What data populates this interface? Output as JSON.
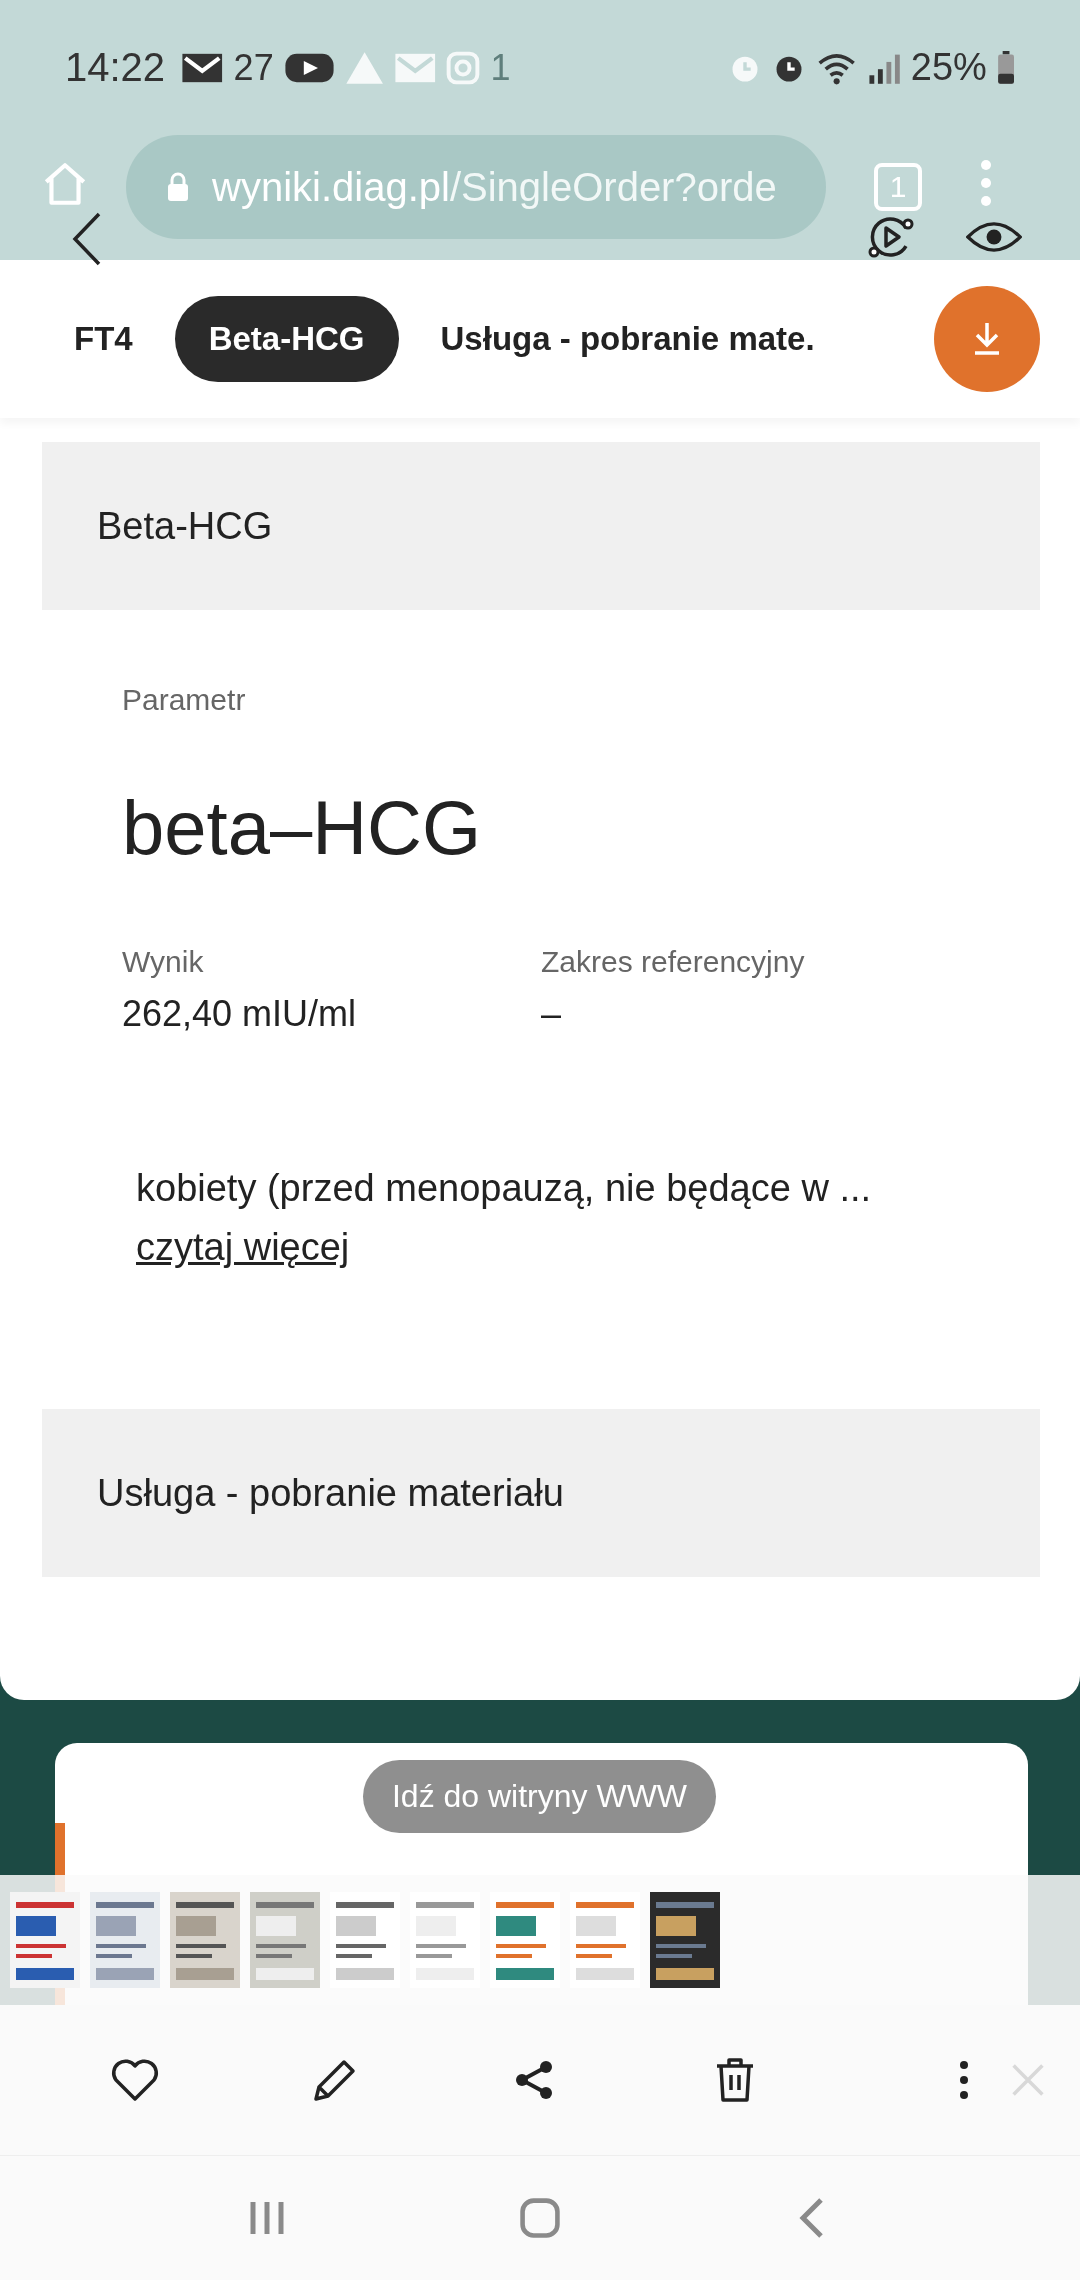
{
  "status_bar": {
    "time": "14:22",
    "notification_count": "27",
    "extra": "1",
    "battery": "25%"
  },
  "browser": {
    "url_host": "wyniki.diag.pl",
    "url_path": "/SingleOrder?orde",
    "tab_count": "1"
  },
  "tabs": [
    {
      "label": "FT4",
      "selected": false
    },
    {
      "label": "Beta-HCG",
      "selected": true
    },
    {
      "label": "Usługa - pobranie mate.",
      "selected": false
    }
  ],
  "section_title": "Beta-HCG",
  "parameter": {
    "label": "Parametr",
    "name": "beta–HCG"
  },
  "result": {
    "label": "Wynik",
    "value": "262,40 mIU/ml"
  },
  "reference": {
    "label": "Zakres referencyjny",
    "value": "–"
  },
  "note": {
    "text": "kobiety (przed menopauzą, nie będące w ...",
    "link": "czytaj więcej"
  },
  "next_section_title": "Usługa - pobranie materiału",
  "visit_button": "Idź do witryny WWW"
}
